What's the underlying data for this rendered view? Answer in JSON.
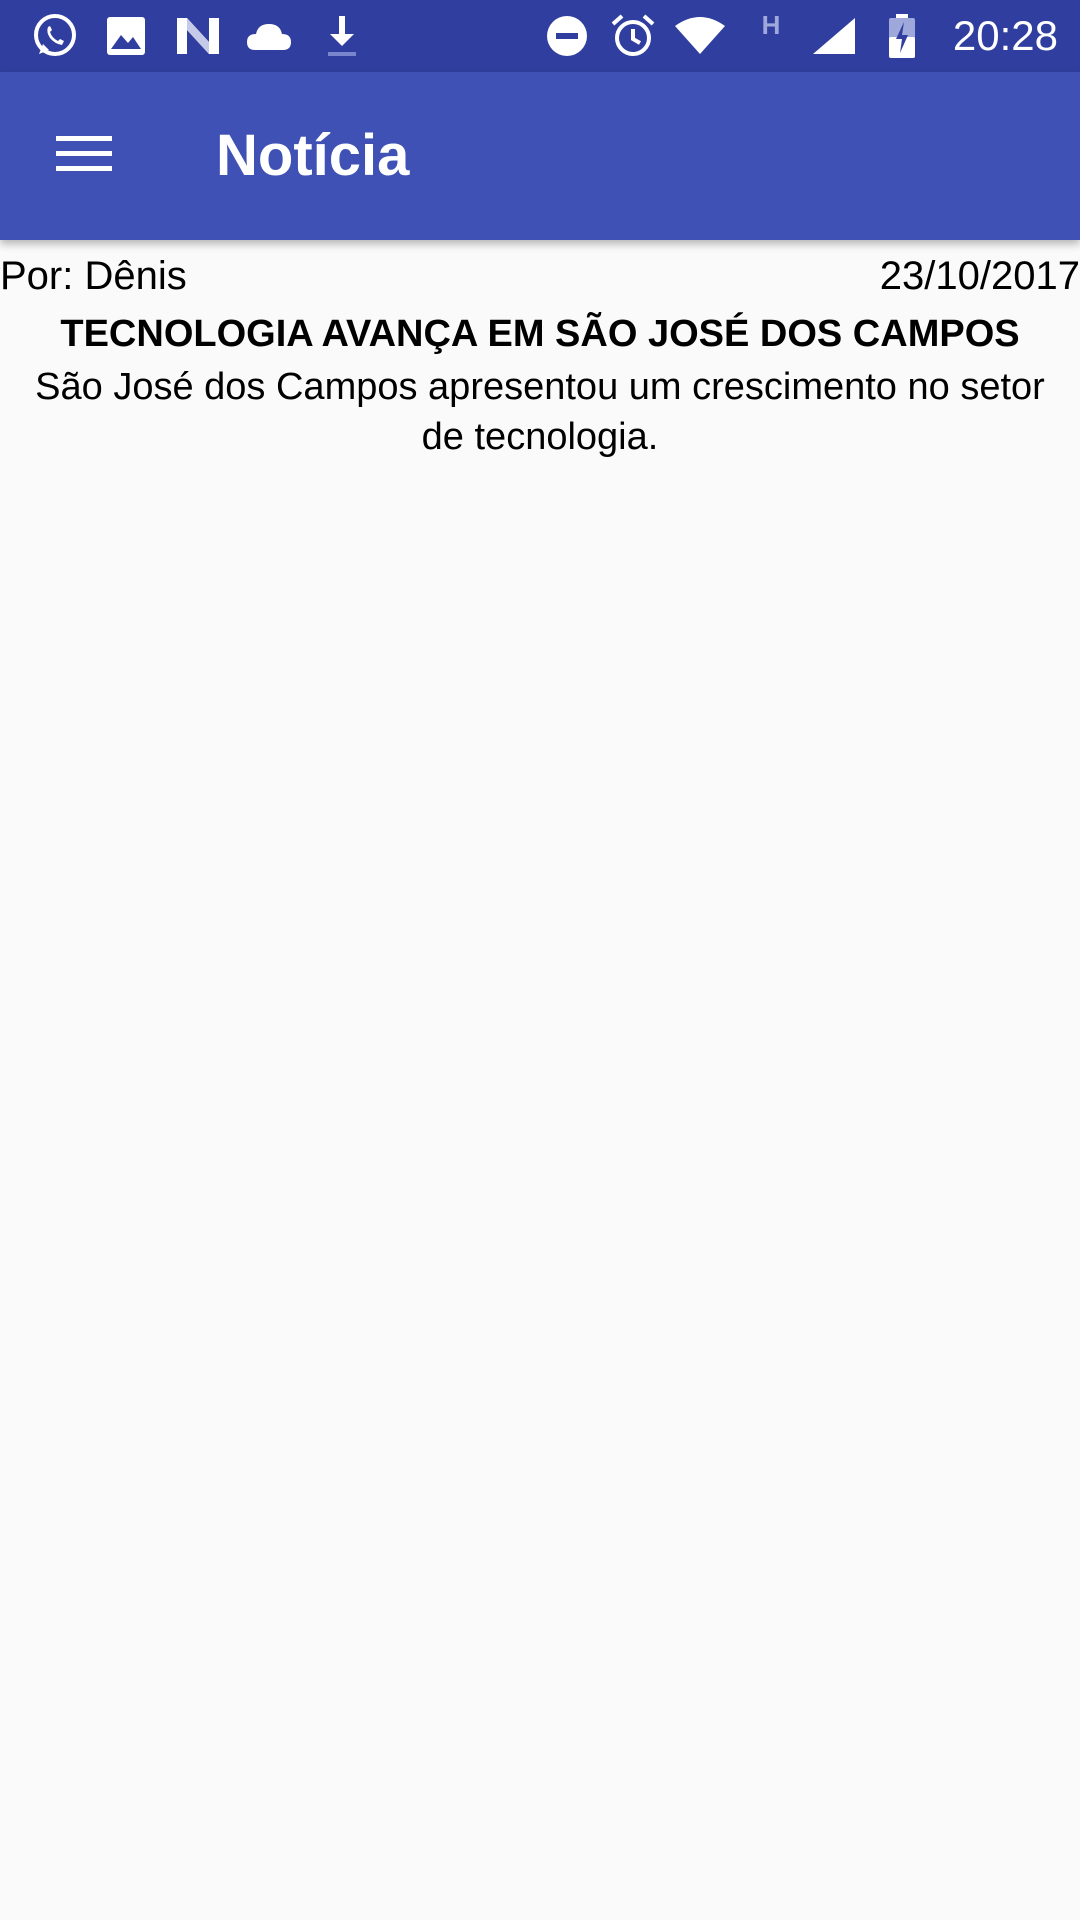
{
  "status_bar": {
    "time": "20:28",
    "background_color": "#303f9f",
    "left_icons": [
      "whatsapp-icon",
      "image-icon",
      "n-app-icon",
      "cloud-icon",
      "download-icon"
    ],
    "right_icons": [
      "do-not-disturb-icon",
      "alarm-icon",
      "wifi-icon",
      "network-h-icon",
      "signal-icon",
      "battery-charging-icon"
    ],
    "network_type": "H"
  },
  "app_bar": {
    "title": "Notícia",
    "menu_icon": "hamburger-menu-icon",
    "background_color": "#3f51b5"
  },
  "article": {
    "author": "Por: Dênis",
    "date": "23/10/2017",
    "headline": "TECNOLOGIA AVANÇA EM SÃO JOSÉ DOS CAMPOS",
    "body": "São José dos Campos apresentou um crescimento no setor de tecnologia."
  }
}
